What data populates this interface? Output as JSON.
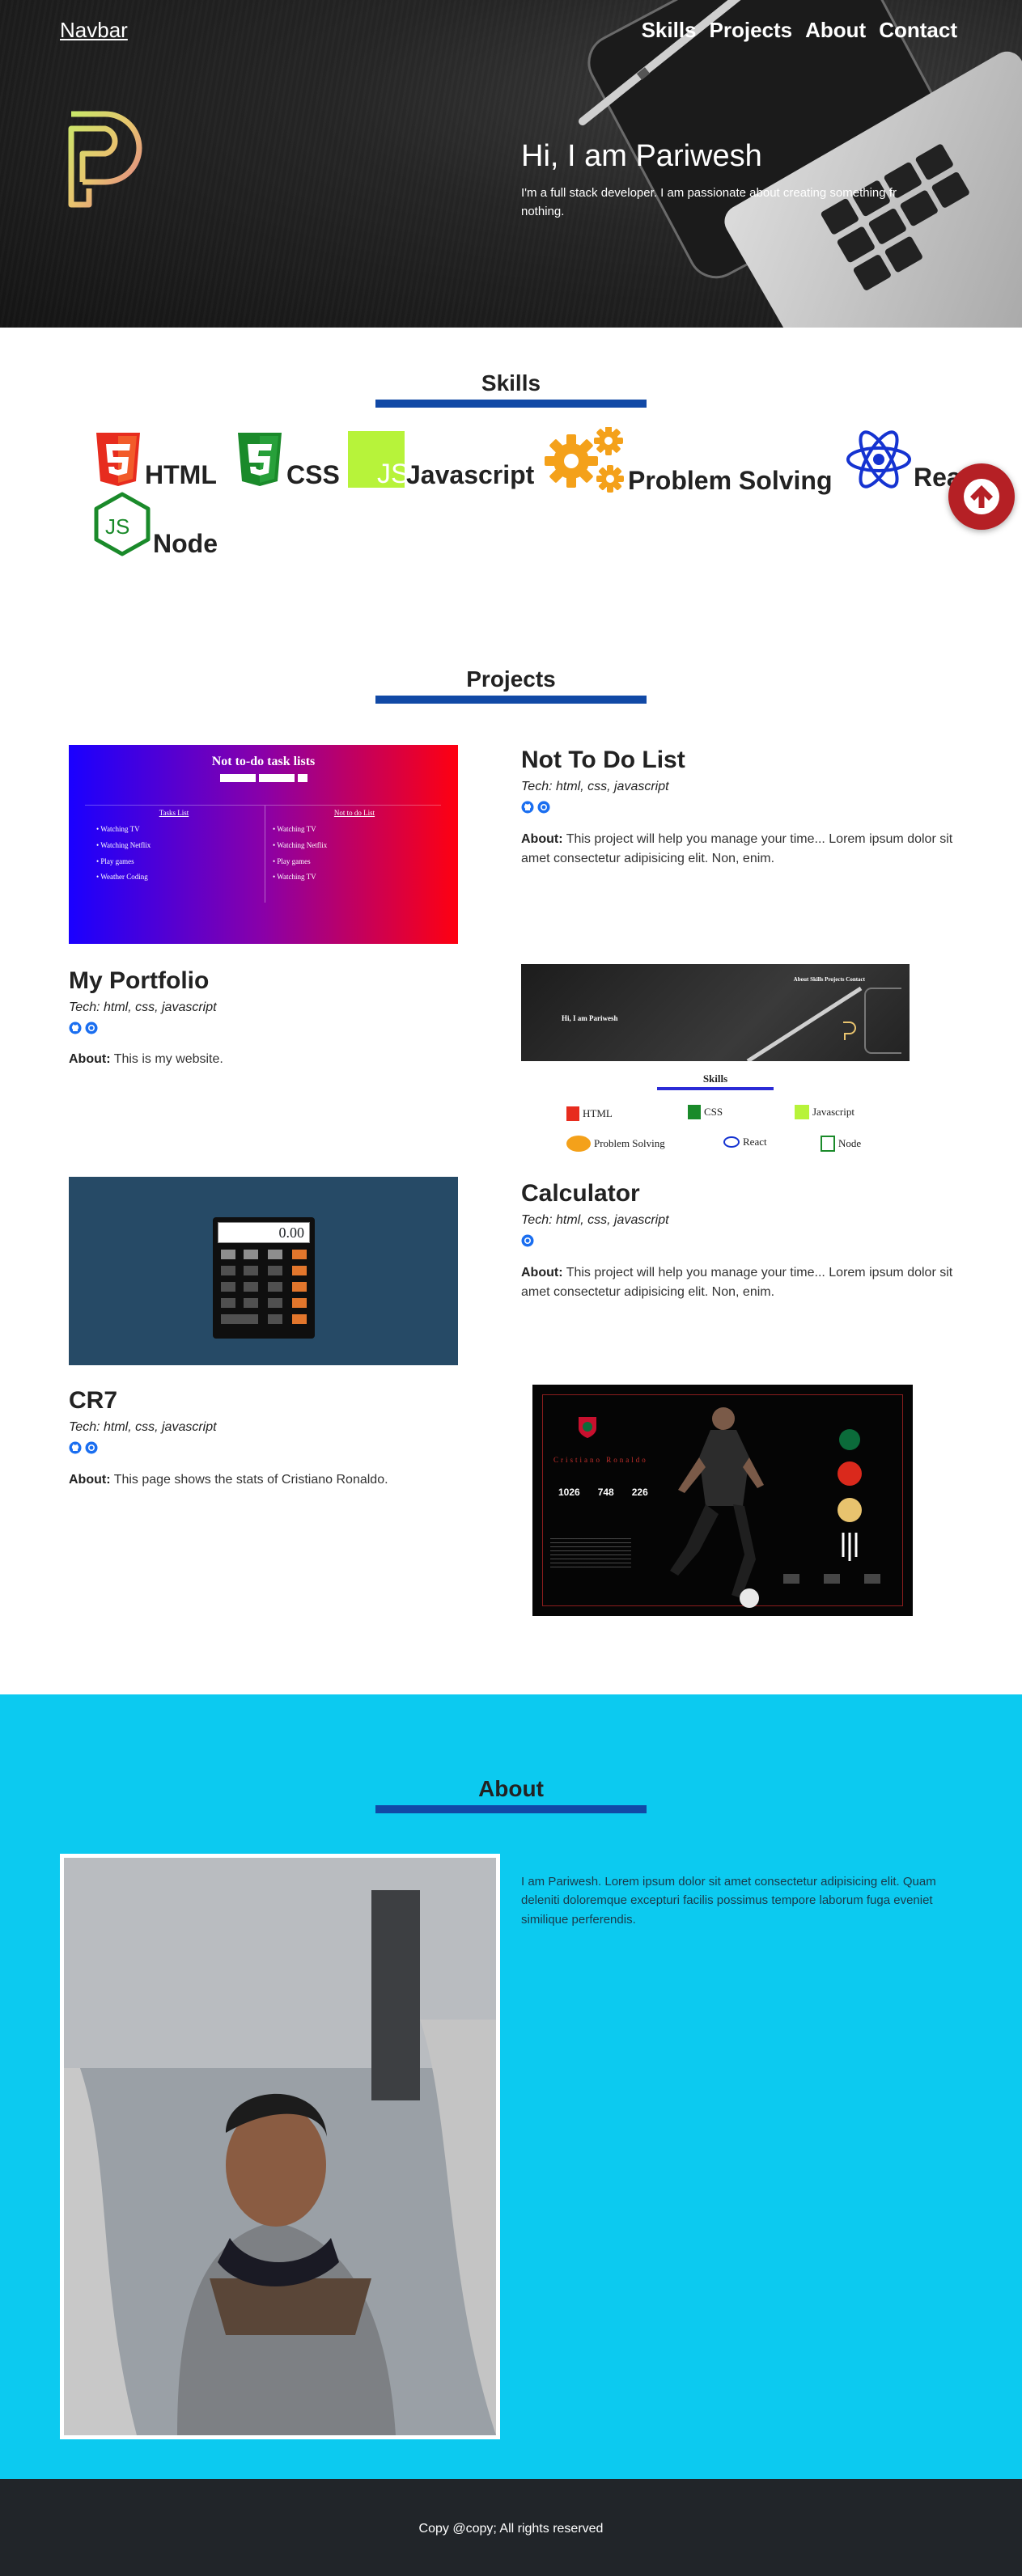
{
  "nav": {
    "brand": "Navbar",
    "links": [
      "Skills",
      "Projects",
      "About",
      "Contact"
    ]
  },
  "hero": {
    "title": "Hi, I am Pariwesh",
    "subtitle_line1": "I'm a full stack developer. I am passionate about creating something fr",
    "subtitle_line2": "nothing."
  },
  "skills": {
    "title": "Skills",
    "items": [
      {
        "label": "HTML",
        "icon": "html5-icon"
      },
      {
        "label": "CSS",
        "icon": "css3-icon"
      },
      {
        "label": "Javascript",
        "icon": "js-icon"
      },
      {
        "label": "Problem Solving",
        "icon": "gears-icon"
      },
      {
        "label": "React",
        "icon": "react-icon"
      },
      {
        "label": "Node",
        "icon": "nodejs-icon"
      }
    ]
  },
  "projects": {
    "title": "Projects",
    "items": [
      {
        "title": "Not To Do List",
        "tech": "Tech: html, css, javascript",
        "about_label": "About:",
        "about": " This project will help you manage your time... Lorem ipsum dolor sit amet consectetur adipisicing elit. Non, enim."
      },
      {
        "title": "My Portfolio",
        "tech": "Tech: html, css, javascript",
        "about_label": "About:",
        "about": " This is my website."
      },
      {
        "title": "Calculator",
        "tech": "Tech: html, css, javascript",
        "about_label": "About:",
        "about": " This project will help you manage your time... Lorem ipsum dolor sit amet consectetur adipisicing elit. Non, enim."
      },
      {
        "title": "CR7",
        "tech": "Tech: html, css, javascript",
        "about_label": "About:",
        "about": " This page shows the stats of Cristiano Ronaldo."
      }
    ],
    "thumb_nottodo": {
      "heading": "Not to-do task lists",
      "col1": "Tasks List",
      "col2": "Not to do List",
      "rows": [
        "Watching TV",
        "Watching Netflix",
        "Play games",
        "Weather Coding"
      ],
      "rows2": [
        "Watching TV",
        "Watching Netflix",
        "Play games",
        "Watching TV"
      ]
    },
    "thumb_portfolio": {
      "nav": "About  Skills  Projects  Contact",
      "hi": "Hi, I am Pariwesh",
      "skills_title": "Skills",
      "skills": [
        "HTML",
        "CSS",
        "Javascript",
        "Problem Solving",
        "React",
        "Node"
      ]
    },
    "thumb_calc": {
      "display": "0.00"
    },
    "thumb_cr7": {
      "name": "Cristiano Ronaldo",
      "stats": [
        "1026",
        "748",
        "226"
      ]
    }
  },
  "about": {
    "title": "About",
    "text": "I am Pariwesh. Lorem ipsum dolor sit amet consectetur adipisicing elit. Quam deleniti doloremque excepturi facilis possimus tempore laborum fuga eveniet similique perferendis."
  },
  "footer": {
    "text": "Copy @copy; All rights reserved"
  },
  "colors": {
    "accent_bar": "#1149a6",
    "about_bg": "#0ccaf0",
    "scroll_button": "#b52025",
    "footer_bg": "#212529"
  }
}
